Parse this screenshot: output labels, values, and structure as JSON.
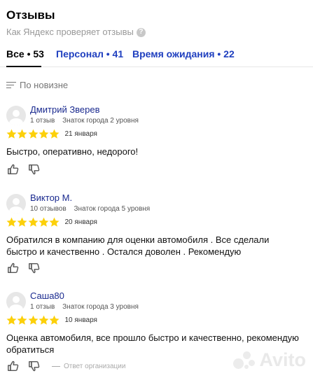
{
  "header": {
    "title": "Отзывы",
    "subtitle": "Как Яндекс проверяет отзывы",
    "help_glyph": "?"
  },
  "tabs": [
    {
      "label": "Все • 53",
      "active": true
    },
    {
      "label": "Персонал • 41",
      "active": false
    },
    {
      "label": "Время ожидания • 22",
      "active": false
    }
  ],
  "sort": {
    "label": "По новизне",
    "icon": "sort-lines-icon"
  },
  "reviews": [
    {
      "author": "Дмитрий Зверев",
      "count": "1 отзыв",
      "level": "Знаток города 2 уровня",
      "rating": 5,
      "date": "21 января",
      "text": "Быстро, оперативно, недорого!"
    },
    {
      "author": "Виктор М.",
      "count": "10 отзывов",
      "level": "Знаток города 5 уровня",
      "rating": 5,
      "date": "20 января",
      "text": "Обратился в компанию для оценки автомобиля . Все сделали быстро и качественно . Остался доволен . Рекомендую"
    },
    {
      "author": "Саша80",
      "count": "1 отзыв",
      "level": "Знаток города 3 уровня",
      "rating": 5,
      "date": "10 января",
      "text": "Оценка автомобиля, все прошло быстро и качественно, рекомендую обратиться",
      "reply": "Ответ организации"
    }
  ],
  "watermark": {
    "text": "Avito"
  },
  "colors": {
    "star": "#fcd00a",
    "link": "#1f3fbf",
    "author": "#1a2a8f",
    "muted": "#999999"
  }
}
